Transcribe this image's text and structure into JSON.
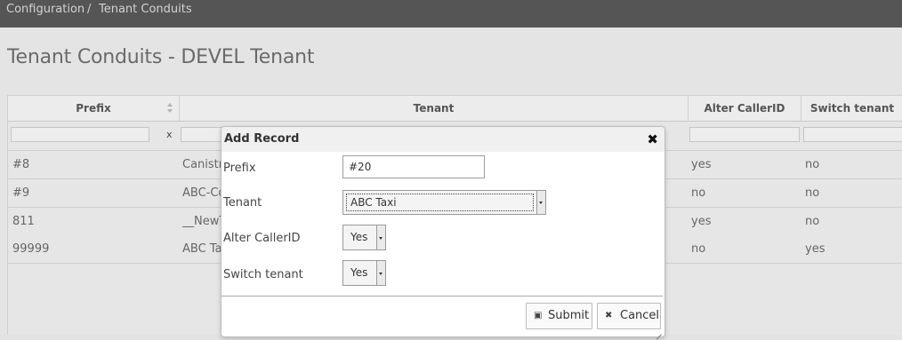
{
  "breadcrumb": {
    "items": [
      "Configuration",
      "Tenant Conduits"
    ],
    "separator": "/"
  },
  "page_title": "Tenant Conduits - DEVEL Tenant",
  "grid": {
    "columns": [
      "Prefix",
      "Tenant",
      "Alter CallerID",
      "Switch tenant"
    ],
    "filter_clear": "x",
    "rows": [
      {
        "prefix": "#8",
        "tenant": "Canistr",
        "alter": "yes",
        "switch": "no"
      },
      {
        "prefix": "#9",
        "tenant": "ABC-Co",
        "alter": "no",
        "switch": "no"
      },
      {
        "prefix": "811",
        "tenant": "__NewT",
        "alter": "yes",
        "switch": "no"
      },
      {
        "prefix": "99999",
        "tenant": "ABC Ta",
        "alter": "no",
        "switch": "yes"
      }
    ]
  },
  "dialog": {
    "title": "Add Record",
    "close_icon": "close-icon",
    "fields": {
      "prefix": {
        "label": "Prefix",
        "value": "#20"
      },
      "tenant": {
        "label": "Tenant",
        "value": "ABC Taxi"
      },
      "alter": {
        "label": "Alter CallerID",
        "value": "Yes"
      },
      "switch": {
        "label": "Switch tenant",
        "value": "Yes"
      }
    },
    "submit_label": "Submit",
    "cancel_label": "Cancel",
    "close_glyph": "✖",
    "cancel_glyph": "✖",
    "submit_glyph": "▣"
  },
  "colors": {
    "topbar": "#555555",
    "background": "#e4e4e4",
    "dialog_bg": "#ffffff"
  }
}
